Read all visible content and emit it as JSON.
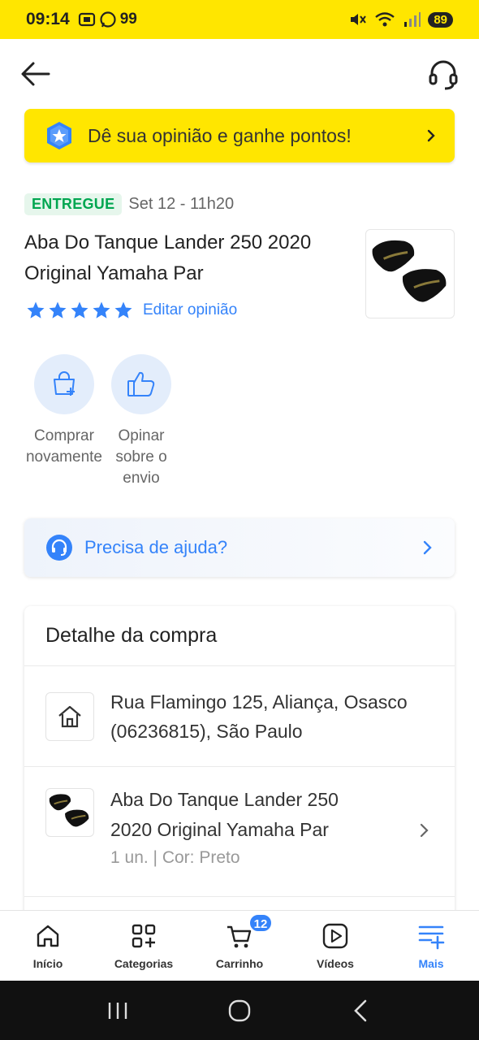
{
  "status_bar": {
    "time": "09:14",
    "notif_count": "99",
    "battery": "89"
  },
  "banner": {
    "text": "Dê sua opinião e ganhe pontos!"
  },
  "order": {
    "status": "ENTREGUE",
    "date": "Set 12 - 11h20",
    "title": "Aba Do Tanque Lander 250 2020 Original Yamaha Par",
    "rating": 5,
    "edit_opinion": "Editar opinião"
  },
  "actions": [
    {
      "label_1": "Comprar",
      "label_2": "novamente",
      "icon": "bag-plus-icon"
    },
    {
      "label_1": "Opinar",
      "label_2": "sobre o",
      "label_3": "envio",
      "icon": "thumbs-up-icon"
    }
  ],
  "help": {
    "text": "Precisa de ajuda?"
  },
  "detail": {
    "title": "Detalhe da compra",
    "address_line1": "Rua Flamingo 125, Aliança, Osasco",
    "address_line2": "(06236815), São Paulo",
    "item_title": "Aba Do Tanque Lander 250 2020 Original Yamaha Par",
    "item_meta": "1 un. | Cor: Preto"
  },
  "tabs": [
    {
      "label": "Início",
      "icon": "home-icon"
    },
    {
      "label": "Categorias",
      "icon": "categories-icon"
    },
    {
      "label": "Carrinho",
      "icon": "cart-icon",
      "badge": "12"
    },
    {
      "label": "Vídeos",
      "icon": "video-icon"
    },
    {
      "label": "Mais",
      "icon": "menu-plus-icon",
      "active": true
    }
  ],
  "colors": {
    "brand_yellow": "#ffe600",
    "accent_blue": "#3483fa",
    "success_green": "#00a650"
  }
}
